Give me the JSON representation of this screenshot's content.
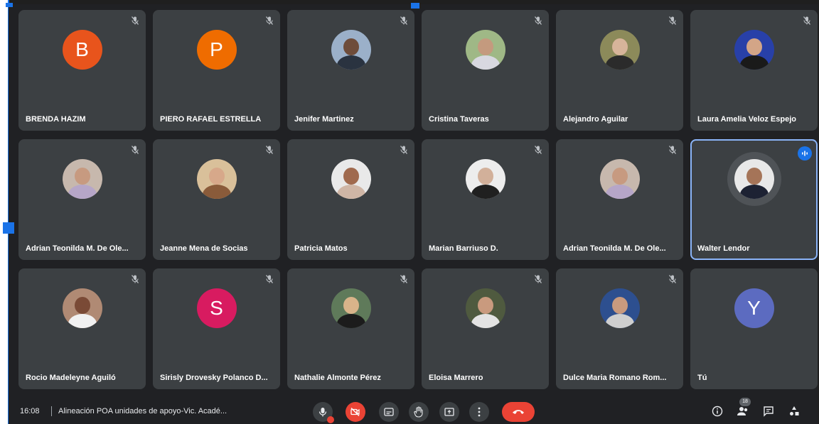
{
  "meeting": {
    "time": "16:08",
    "title": "Alineación POA unidades de apoyo-Vic. Acadé..."
  },
  "participants": [
    {
      "name": "BRENDA HAZIM",
      "avatar": {
        "type": "letter",
        "letter": "B",
        "color": "#e8541c"
      },
      "muted": true
    },
    {
      "name": "PIERO RAFAEL ESTRELLA",
      "avatar": {
        "type": "letter",
        "letter": "P",
        "color": "#ef6c00"
      },
      "muted": true
    },
    {
      "name": "Jenifer Martinez",
      "avatar": {
        "type": "photo",
        "bg": "#9bb0c9",
        "skin": "#6e4c3a",
        "cloth": "#2a3340"
      },
      "muted": true
    },
    {
      "name": "Cristina Taveras",
      "avatar": {
        "type": "photo",
        "bg": "#9fb886",
        "skin": "#c49a7e",
        "cloth": "#d8d8e0"
      },
      "muted": true
    },
    {
      "name": "Alejandro Aguilar",
      "avatar": {
        "type": "photo",
        "bg": "#8c8a5a",
        "skin": "#d7b49a",
        "cloth": "#2b2b2b"
      },
      "muted": true
    },
    {
      "name": "Laura Amelia Veloz Espejo",
      "avatar": {
        "type": "photo",
        "bg": "#2840a8",
        "skin": "#d3a587",
        "cloth": "#1a1a1a"
      },
      "muted": true
    },
    {
      "name": "Adrian Teonilda M. De Ole...",
      "avatar": {
        "type": "photo",
        "bg": "#c7b8ad",
        "skin": "#c79a80",
        "cloth": "#b6a6c8"
      },
      "muted": true
    },
    {
      "name": "Jeanne Mena de Socias",
      "avatar": {
        "type": "photo",
        "bg": "#d9c09a",
        "skin": "#d7a88a",
        "cloth": "#8a5b3a"
      },
      "muted": true
    },
    {
      "name": "Patricia Matos",
      "avatar": {
        "type": "photo",
        "bg": "#e9e9e9",
        "skin": "#a06a4e",
        "cloth": "#cfb6a6"
      },
      "muted": true
    },
    {
      "name": "Marian Barriuso D.",
      "avatar": {
        "type": "photo",
        "bg": "#ededed",
        "skin": "#d2b09a",
        "cloth": "#202020"
      },
      "muted": true
    },
    {
      "name": "Adrian Teonilda M. De Ole...",
      "avatar": {
        "type": "photo",
        "bg": "#c7b8ad",
        "skin": "#c79a80",
        "cloth": "#b6a6c8"
      },
      "muted": true
    },
    {
      "name": "Walter Lendor",
      "avatar": {
        "type": "photo",
        "bg": "#e8e8e8",
        "skin": "#a57458",
        "cloth": "#1d2233"
      },
      "muted": false,
      "speaking": true
    },
    {
      "name": "Rocio Madeleyne Aguiló",
      "avatar": {
        "type": "photo",
        "bg": "#b08a74",
        "skin": "#7a4a36",
        "cloth": "#f1f1f1"
      },
      "muted": true
    },
    {
      "name": "Sirisly Drovesky Polanco D...",
      "avatar": {
        "type": "letter",
        "letter": "S",
        "color": "#d81b60"
      },
      "muted": true
    },
    {
      "name": "Nathalie Almonte Pérez",
      "avatar": {
        "type": "photo",
        "bg": "#5f7a5a",
        "skin": "#d9b48a",
        "cloth": "#1c1c1c"
      },
      "muted": true
    },
    {
      "name": "Eloisa Marrero",
      "avatar": {
        "type": "photo",
        "bg": "#4f5a3f",
        "skin": "#c99a7e",
        "cloth": "#e3e3e3"
      },
      "muted": true
    },
    {
      "name": "Dulce Maria Romano Rom...",
      "avatar": {
        "type": "photo",
        "bg": "#2d4f8f",
        "skin": "#c99a7e",
        "cloth": "#cfcfcf"
      },
      "muted": true
    },
    {
      "name": "Tú",
      "avatar": {
        "type": "letter",
        "letter": "Y",
        "color": "#5c6bc0"
      },
      "muted": false
    }
  ],
  "controls": {
    "mic_icon": "mic-icon",
    "camera_icon": "camera-off-icon",
    "captions_icon": "captions-icon",
    "raise_hand_icon": "raise-hand-icon",
    "present_icon": "present-icon",
    "more_icon": "more-options-icon",
    "end_call_icon": "end-call-icon"
  },
  "right_controls": {
    "info_icon": "info-icon",
    "people_count": "18",
    "people_icon": "people-icon",
    "chat_icon": "chat-icon",
    "activities_icon": "activities-icon"
  }
}
